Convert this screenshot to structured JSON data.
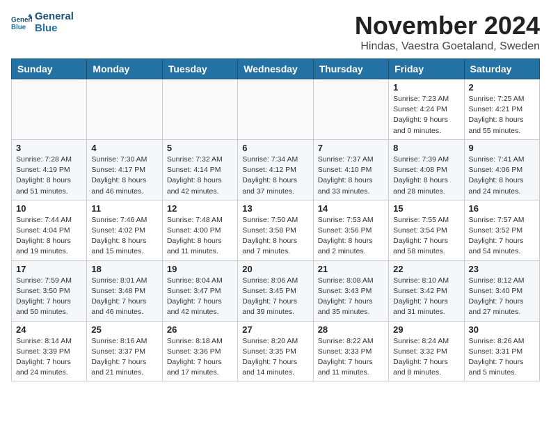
{
  "header": {
    "logo_line1": "General",
    "logo_line2": "Blue",
    "month_title": "November 2024",
    "subtitle": "Hindas, Vaestra Goetaland, Sweden"
  },
  "weekdays": [
    "Sunday",
    "Monday",
    "Tuesday",
    "Wednesday",
    "Thursday",
    "Friday",
    "Saturday"
  ],
  "weeks": [
    [
      {
        "day": "",
        "info": ""
      },
      {
        "day": "",
        "info": ""
      },
      {
        "day": "",
        "info": ""
      },
      {
        "day": "",
        "info": ""
      },
      {
        "day": "",
        "info": ""
      },
      {
        "day": "1",
        "info": "Sunrise: 7:23 AM\nSunset: 4:24 PM\nDaylight: 9 hours and 0 minutes."
      },
      {
        "day": "2",
        "info": "Sunrise: 7:25 AM\nSunset: 4:21 PM\nDaylight: 8 hours and 55 minutes."
      }
    ],
    [
      {
        "day": "3",
        "info": "Sunrise: 7:28 AM\nSunset: 4:19 PM\nDaylight: 8 hours and 51 minutes."
      },
      {
        "day": "4",
        "info": "Sunrise: 7:30 AM\nSunset: 4:17 PM\nDaylight: 8 hours and 46 minutes."
      },
      {
        "day": "5",
        "info": "Sunrise: 7:32 AM\nSunset: 4:14 PM\nDaylight: 8 hours and 42 minutes."
      },
      {
        "day": "6",
        "info": "Sunrise: 7:34 AM\nSunset: 4:12 PM\nDaylight: 8 hours and 37 minutes."
      },
      {
        "day": "7",
        "info": "Sunrise: 7:37 AM\nSunset: 4:10 PM\nDaylight: 8 hours and 33 minutes."
      },
      {
        "day": "8",
        "info": "Sunrise: 7:39 AM\nSunset: 4:08 PM\nDaylight: 8 hours and 28 minutes."
      },
      {
        "day": "9",
        "info": "Sunrise: 7:41 AM\nSunset: 4:06 PM\nDaylight: 8 hours and 24 minutes."
      }
    ],
    [
      {
        "day": "10",
        "info": "Sunrise: 7:44 AM\nSunset: 4:04 PM\nDaylight: 8 hours and 19 minutes."
      },
      {
        "day": "11",
        "info": "Sunrise: 7:46 AM\nSunset: 4:02 PM\nDaylight: 8 hours and 15 minutes."
      },
      {
        "day": "12",
        "info": "Sunrise: 7:48 AM\nSunset: 4:00 PM\nDaylight: 8 hours and 11 minutes."
      },
      {
        "day": "13",
        "info": "Sunrise: 7:50 AM\nSunset: 3:58 PM\nDaylight: 8 hours and 7 minutes."
      },
      {
        "day": "14",
        "info": "Sunrise: 7:53 AM\nSunset: 3:56 PM\nDaylight: 8 hours and 2 minutes."
      },
      {
        "day": "15",
        "info": "Sunrise: 7:55 AM\nSunset: 3:54 PM\nDaylight: 7 hours and 58 minutes."
      },
      {
        "day": "16",
        "info": "Sunrise: 7:57 AM\nSunset: 3:52 PM\nDaylight: 7 hours and 54 minutes."
      }
    ],
    [
      {
        "day": "17",
        "info": "Sunrise: 7:59 AM\nSunset: 3:50 PM\nDaylight: 7 hours and 50 minutes."
      },
      {
        "day": "18",
        "info": "Sunrise: 8:01 AM\nSunset: 3:48 PM\nDaylight: 7 hours and 46 minutes."
      },
      {
        "day": "19",
        "info": "Sunrise: 8:04 AM\nSunset: 3:47 PM\nDaylight: 7 hours and 42 minutes."
      },
      {
        "day": "20",
        "info": "Sunrise: 8:06 AM\nSunset: 3:45 PM\nDaylight: 7 hours and 39 minutes."
      },
      {
        "day": "21",
        "info": "Sunrise: 8:08 AM\nSunset: 3:43 PM\nDaylight: 7 hours and 35 minutes."
      },
      {
        "day": "22",
        "info": "Sunrise: 8:10 AM\nSunset: 3:42 PM\nDaylight: 7 hours and 31 minutes."
      },
      {
        "day": "23",
        "info": "Sunrise: 8:12 AM\nSunset: 3:40 PM\nDaylight: 7 hours and 27 minutes."
      }
    ],
    [
      {
        "day": "24",
        "info": "Sunrise: 8:14 AM\nSunset: 3:39 PM\nDaylight: 7 hours and 24 minutes."
      },
      {
        "day": "25",
        "info": "Sunrise: 8:16 AM\nSunset: 3:37 PM\nDaylight: 7 hours and 21 minutes."
      },
      {
        "day": "26",
        "info": "Sunrise: 8:18 AM\nSunset: 3:36 PM\nDaylight: 7 hours and 17 minutes."
      },
      {
        "day": "27",
        "info": "Sunrise: 8:20 AM\nSunset: 3:35 PM\nDaylight: 7 hours and 14 minutes."
      },
      {
        "day": "28",
        "info": "Sunrise: 8:22 AM\nSunset: 3:33 PM\nDaylight: 7 hours and 11 minutes."
      },
      {
        "day": "29",
        "info": "Sunrise: 8:24 AM\nSunset: 3:32 PM\nDaylight: 7 hours and 8 minutes."
      },
      {
        "day": "30",
        "info": "Sunrise: 8:26 AM\nSunset: 3:31 PM\nDaylight: 7 hours and 5 minutes."
      }
    ]
  ]
}
